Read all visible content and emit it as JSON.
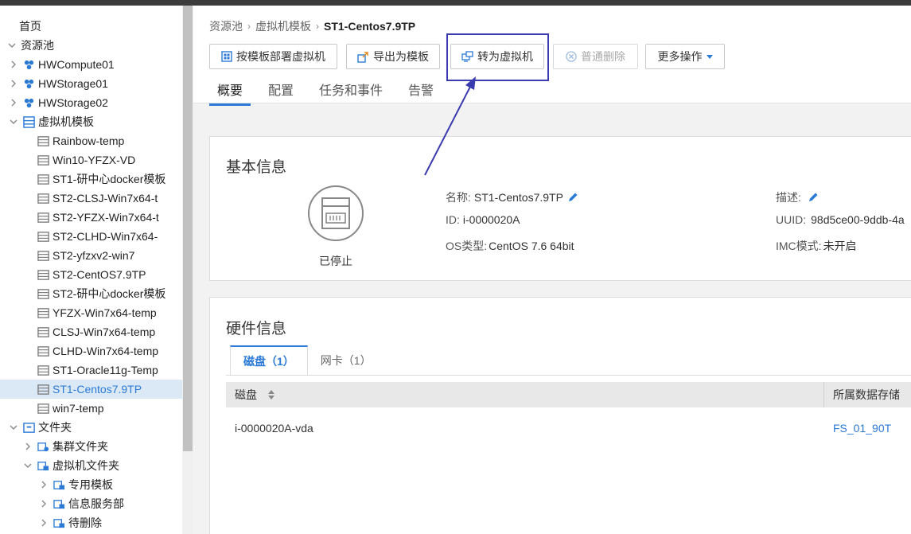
{
  "sidebar": {
    "items": [
      {
        "label": "首页",
        "icon": "none",
        "level": 0,
        "toggle": "none"
      },
      {
        "label": "资源池",
        "icon": "none",
        "level": 0,
        "toggle": "expanded"
      },
      {
        "label": "HWCompute01",
        "icon": "cluster-icon",
        "level": 1,
        "toggle": "collapsed"
      },
      {
        "label": "HWStorage01",
        "icon": "cluster-icon",
        "level": 1,
        "toggle": "collapsed"
      },
      {
        "label": "HWStorage02",
        "icon": "cluster-icon",
        "level": 1,
        "toggle": "collapsed"
      },
      {
        "label": "虚拟机模板",
        "icon": "template-folder-icon",
        "level": 1,
        "toggle": "expanded"
      },
      {
        "label": "Rainbow-temp",
        "icon": "template-icon",
        "level": 2,
        "toggle": "none"
      },
      {
        "label": "Win10-YFZX-VD",
        "icon": "template-icon",
        "level": 2,
        "toggle": "none"
      },
      {
        "label": "ST1-研中心docker模板",
        "icon": "template-icon",
        "level": 2,
        "toggle": "none"
      },
      {
        "label": "ST2-CLSJ-Win7x64-t",
        "icon": "template-icon",
        "level": 2,
        "toggle": "none"
      },
      {
        "label": "ST2-YFZX-Win7x64-t",
        "icon": "template-icon",
        "level": 2,
        "toggle": "none"
      },
      {
        "label": "ST2-CLHD-Win7x64-",
        "icon": "template-icon",
        "level": 2,
        "toggle": "none"
      },
      {
        "label": "ST2-yfzxv2-win7",
        "icon": "template-icon",
        "level": 2,
        "toggle": "none"
      },
      {
        "label": "ST2-CentOS7.9TP",
        "icon": "template-icon",
        "level": 2,
        "toggle": "none"
      },
      {
        "label": "ST2-研中心docker模板",
        "icon": "template-icon",
        "level": 2,
        "toggle": "none"
      },
      {
        "label": "YFZX-Win7x64-temp",
        "icon": "template-icon",
        "level": 2,
        "toggle": "none"
      },
      {
        "label": "CLSJ-Win7x64-temp",
        "icon": "template-icon",
        "level": 2,
        "toggle": "none"
      },
      {
        "label": "CLHD-Win7x64-temp",
        "icon": "template-icon",
        "level": 2,
        "toggle": "none"
      },
      {
        "label": "ST1-Oracle11g-Temp",
        "icon": "template-icon",
        "level": 2,
        "toggle": "none"
      },
      {
        "label": "ST1-Centos7.9TP",
        "icon": "template-icon",
        "level": 2,
        "toggle": "none",
        "selected": true
      },
      {
        "label": "win7-temp",
        "icon": "template-icon",
        "level": 2,
        "toggle": "none"
      },
      {
        "label": "文件夹",
        "icon": "folder-icon",
        "level": 1,
        "toggle": "expanded"
      },
      {
        "label": "集群文件夹",
        "icon": "cluster-folder-icon",
        "level": 2,
        "toggle": "collapsed"
      },
      {
        "label": "虚拟机文件夹",
        "icon": "vm-folder-icon",
        "level": 2,
        "toggle": "expanded"
      },
      {
        "label": "专用模板",
        "icon": "vm-folder-icon",
        "level": 3,
        "toggle": "collapsed"
      },
      {
        "label": "信息服务部",
        "icon": "vm-folder-icon",
        "level": 3,
        "toggle": "collapsed"
      },
      {
        "label": "待删除",
        "icon": "vm-folder-icon",
        "level": 3,
        "toggle": "collapsed"
      }
    ]
  },
  "breadcrumb": {
    "items": [
      "资源池",
      "虚拟机模板"
    ],
    "current": "ST1-Centos7.9TP",
    "separator": "›"
  },
  "toolbar": {
    "deploy_label": "按模板部署虚拟机",
    "export_label": "导出为模板",
    "convert_label": "转为虚拟机",
    "delete_label": "普通删除",
    "more_label": "更多操作"
  },
  "tabs": [
    "概要",
    "配置",
    "任务和事件",
    "告警"
  ],
  "basic_info": {
    "title": "基本信息",
    "status": "已停止",
    "name_key": "名称:",
    "name_value": "ST1-Centos7.9TP",
    "id_key": "ID:",
    "id_value": "i-0000020A",
    "os_key": "OS类型:",
    "os_value": "CentOS 7.6 64bit",
    "desc_key": "描述:",
    "uuid_key": "UUID:",
    "uuid_value": "98d5ce00-9ddb-4a",
    "imc_key": "IMC模式:",
    "imc_value": "未开启"
  },
  "hardware_info": {
    "title": "硬件信息",
    "subtabs": [
      "磁盘（1）",
      "网卡（1）"
    ],
    "columns": [
      "磁盘",
      "所属数据存储"
    ],
    "rows": [
      {
        "disk": "i-0000020A-vda",
        "datastore": "FS_01_90T"
      }
    ]
  },
  "colors": {
    "accent": "#2b7ad6",
    "highlight": "#3b3bb0"
  }
}
